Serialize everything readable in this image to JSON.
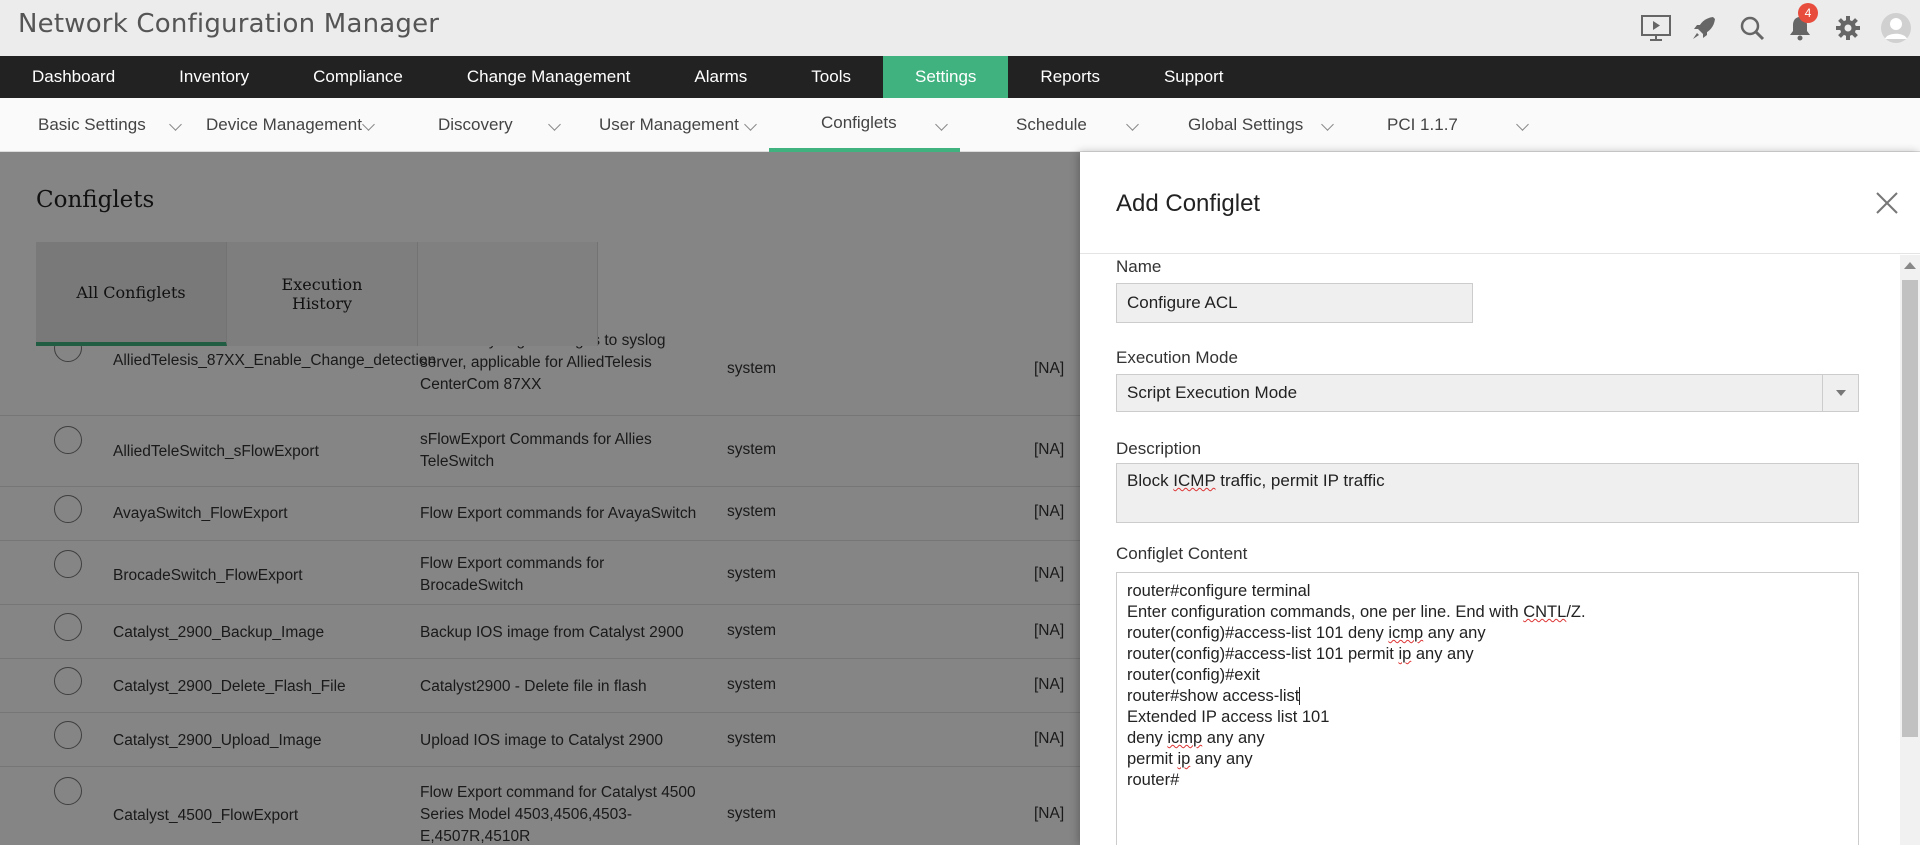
{
  "app": {
    "title": "Network Configuration Manager",
    "notification_count": "4"
  },
  "main_nav": [
    {
      "label": "Dashboard"
    },
    {
      "label": "Inventory"
    },
    {
      "label": "Compliance"
    },
    {
      "label": "Change Management"
    },
    {
      "label": "Alarms"
    },
    {
      "label": "Tools"
    },
    {
      "label": "Settings"
    },
    {
      "label": "Reports"
    },
    {
      "label": "Support"
    }
  ],
  "sub_nav": [
    {
      "label": "Basic Settings"
    },
    {
      "label": "Device Management"
    },
    {
      "label": "Discovery"
    },
    {
      "label": "User Management"
    },
    {
      "label": "Configlets"
    },
    {
      "label": "Schedule"
    },
    {
      "label": "Global Settings"
    },
    {
      "label": "PCI 1.1.7"
    }
  ],
  "page": {
    "title": "Configlets",
    "tabs": [
      {
        "label": "All Configlets"
      },
      {
        "label": "Execution History"
      }
    ],
    "rows": [
      {
        "name": "AlliedTelesis_87XX_Enable_Change_detection",
        "desc": "Forward syslog messages to syslog server, applicable for AlliedTelesis CenterCom 87XX",
        "owner": "system",
        "na": "[NA]"
      },
      {
        "name": "AlliedTeleSwitch_sFlowExport",
        "desc": "sFlowExport Commands for Allies TeleSwitch",
        "owner": "system",
        "na": "[NA]"
      },
      {
        "name": "AvayaSwitch_FlowExport",
        "desc": "Flow Export commands for AvayaSwitch",
        "owner": "system",
        "na": "[NA]"
      },
      {
        "name": "BrocadeSwitch_FlowExport",
        "desc": "Flow Export commands for BrocadeSwitch",
        "owner": "system",
        "na": "[NA]"
      },
      {
        "name": "Catalyst_2900_Backup_Image",
        "desc": "Backup IOS image from Catalyst 2900",
        "owner": "system",
        "na": "[NA]"
      },
      {
        "name": "Catalyst_2900_Delete_Flash_File",
        "desc": "Catalyst2900 - Delete file in flash",
        "owner": "system",
        "na": "[NA]"
      },
      {
        "name": "Catalyst_2900_Upload_Image",
        "desc": "Upload IOS image to Catalyst 2900",
        "owner": "system",
        "na": "[NA]"
      },
      {
        "name": "Catalyst_4500_FlowExport",
        "desc": "Flow Export command for Catalyst 4500 Series Model 4503,4506,4503-E,4507R,4510R",
        "owner": "system",
        "na": "[NA]"
      }
    ]
  },
  "drawer": {
    "title": "Add Configlet",
    "name_label": "Name",
    "name_value": "Configure ACL",
    "mode_label": "Execution Mode",
    "mode_value": "Script Execution Mode",
    "desc_label": "Description",
    "desc_value": "Block ICMP traffic, permit IP traffic",
    "content_label": "Configlet Content",
    "content_lines": [
      "router#configure terminal",
      "Enter configuration commands, one per line. End with CNTL/Z.",
      "router(config)#access-list 101 deny icmp any any",
      "router(config)#access-list 101 permit ip any any",
      "router(config)#exit",
      "router#show access-list",
      "Extended IP access list 101",
      "deny icmp any any",
      "permit ip any any",
      "router#"
    ]
  },
  "colors": {
    "accent": "#3fb27f",
    "nav_bg": "#222222",
    "badge": "#e74c3c"
  }
}
